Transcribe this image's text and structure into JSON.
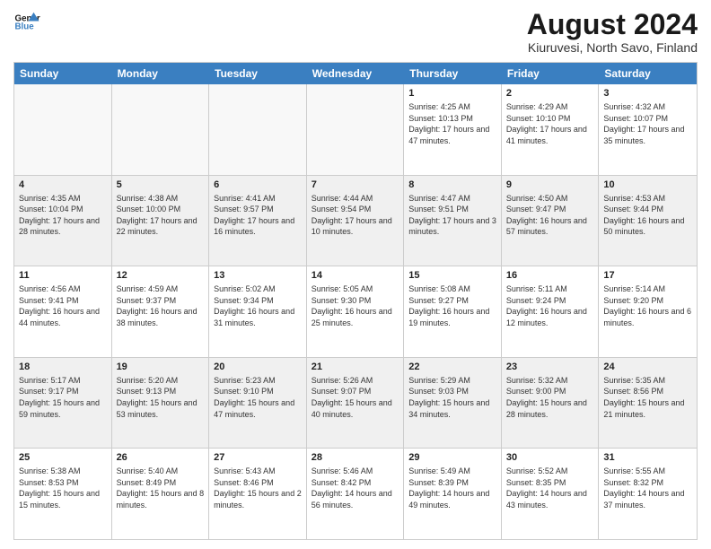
{
  "logo": {
    "line1": "General",
    "line2": "Blue"
  },
  "title": "August 2024",
  "subtitle": "Kiuruvesi, North Savo, Finland",
  "header_days": [
    "Sunday",
    "Monday",
    "Tuesday",
    "Wednesday",
    "Thursday",
    "Friday",
    "Saturday"
  ],
  "rows": [
    [
      {
        "day": "",
        "text": "",
        "empty": true
      },
      {
        "day": "",
        "text": "",
        "empty": true
      },
      {
        "day": "",
        "text": "",
        "empty": true
      },
      {
        "day": "",
        "text": "",
        "empty": true
      },
      {
        "day": "1",
        "text": "Sunrise: 4:25 AM\nSunset: 10:13 PM\nDaylight: 17 hours\nand 47 minutes."
      },
      {
        "day": "2",
        "text": "Sunrise: 4:29 AM\nSunset: 10:10 PM\nDaylight: 17 hours\nand 41 minutes."
      },
      {
        "day": "3",
        "text": "Sunrise: 4:32 AM\nSunset: 10:07 PM\nDaylight: 17 hours\nand 35 minutes."
      }
    ],
    [
      {
        "day": "4",
        "text": "Sunrise: 4:35 AM\nSunset: 10:04 PM\nDaylight: 17 hours\nand 28 minutes."
      },
      {
        "day": "5",
        "text": "Sunrise: 4:38 AM\nSunset: 10:00 PM\nDaylight: 17 hours\nand 22 minutes."
      },
      {
        "day": "6",
        "text": "Sunrise: 4:41 AM\nSunset: 9:57 PM\nDaylight: 17 hours\nand 16 minutes."
      },
      {
        "day": "7",
        "text": "Sunrise: 4:44 AM\nSunset: 9:54 PM\nDaylight: 17 hours\nand 10 minutes."
      },
      {
        "day": "8",
        "text": "Sunrise: 4:47 AM\nSunset: 9:51 PM\nDaylight: 17 hours\nand 3 minutes."
      },
      {
        "day": "9",
        "text": "Sunrise: 4:50 AM\nSunset: 9:47 PM\nDaylight: 16 hours\nand 57 minutes."
      },
      {
        "day": "10",
        "text": "Sunrise: 4:53 AM\nSunset: 9:44 PM\nDaylight: 16 hours\nand 50 minutes."
      }
    ],
    [
      {
        "day": "11",
        "text": "Sunrise: 4:56 AM\nSunset: 9:41 PM\nDaylight: 16 hours\nand 44 minutes."
      },
      {
        "day": "12",
        "text": "Sunrise: 4:59 AM\nSunset: 9:37 PM\nDaylight: 16 hours\nand 38 minutes."
      },
      {
        "day": "13",
        "text": "Sunrise: 5:02 AM\nSunset: 9:34 PM\nDaylight: 16 hours\nand 31 minutes."
      },
      {
        "day": "14",
        "text": "Sunrise: 5:05 AM\nSunset: 9:30 PM\nDaylight: 16 hours\nand 25 minutes."
      },
      {
        "day": "15",
        "text": "Sunrise: 5:08 AM\nSunset: 9:27 PM\nDaylight: 16 hours\nand 19 minutes."
      },
      {
        "day": "16",
        "text": "Sunrise: 5:11 AM\nSunset: 9:24 PM\nDaylight: 16 hours\nand 12 minutes."
      },
      {
        "day": "17",
        "text": "Sunrise: 5:14 AM\nSunset: 9:20 PM\nDaylight: 16 hours\nand 6 minutes."
      }
    ],
    [
      {
        "day": "18",
        "text": "Sunrise: 5:17 AM\nSunset: 9:17 PM\nDaylight: 15 hours\nand 59 minutes."
      },
      {
        "day": "19",
        "text": "Sunrise: 5:20 AM\nSunset: 9:13 PM\nDaylight: 15 hours\nand 53 minutes."
      },
      {
        "day": "20",
        "text": "Sunrise: 5:23 AM\nSunset: 9:10 PM\nDaylight: 15 hours\nand 47 minutes."
      },
      {
        "day": "21",
        "text": "Sunrise: 5:26 AM\nSunset: 9:07 PM\nDaylight: 15 hours\nand 40 minutes."
      },
      {
        "day": "22",
        "text": "Sunrise: 5:29 AM\nSunset: 9:03 PM\nDaylight: 15 hours\nand 34 minutes."
      },
      {
        "day": "23",
        "text": "Sunrise: 5:32 AM\nSunset: 9:00 PM\nDaylight: 15 hours\nand 28 minutes."
      },
      {
        "day": "24",
        "text": "Sunrise: 5:35 AM\nSunset: 8:56 PM\nDaylight: 15 hours\nand 21 minutes."
      }
    ],
    [
      {
        "day": "25",
        "text": "Sunrise: 5:38 AM\nSunset: 8:53 PM\nDaylight: 15 hours\nand 15 minutes."
      },
      {
        "day": "26",
        "text": "Sunrise: 5:40 AM\nSunset: 8:49 PM\nDaylight: 15 hours\nand 8 minutes."
      },
      {
        "day": "27",
        "text": "Sunrise: 5:43 AM\nSunset: 8:46 PM\nDaylight: 15 hours\nand 2 minutes."
      },
      {
        "day": "28",
        "text": "Sunrise: 5:46 AM\nSunset: 8:42 PM\nDaylight: 14 hours\nand 56 minutes."
      },
      {
        "day": "29",
        "text": "Sunrise: 5:49 AM\nSunset: 8:39 PM\nDaylight: 14 hours\nand 49 minutes."
      },
      {
        "day": "30",
        "text": "Sunrise: 5:52 AM\nSunset: 8:35 PM\nDaylight: 14 hours\nand 43 minutes."
      },
      {
        "day": "31",
        "text": "Sunrise: 5:55 AM\nSunset: 8:32 PM\nDaylight: 14 hours\nand 37 minutes."
      }
    ]
  ]
}
